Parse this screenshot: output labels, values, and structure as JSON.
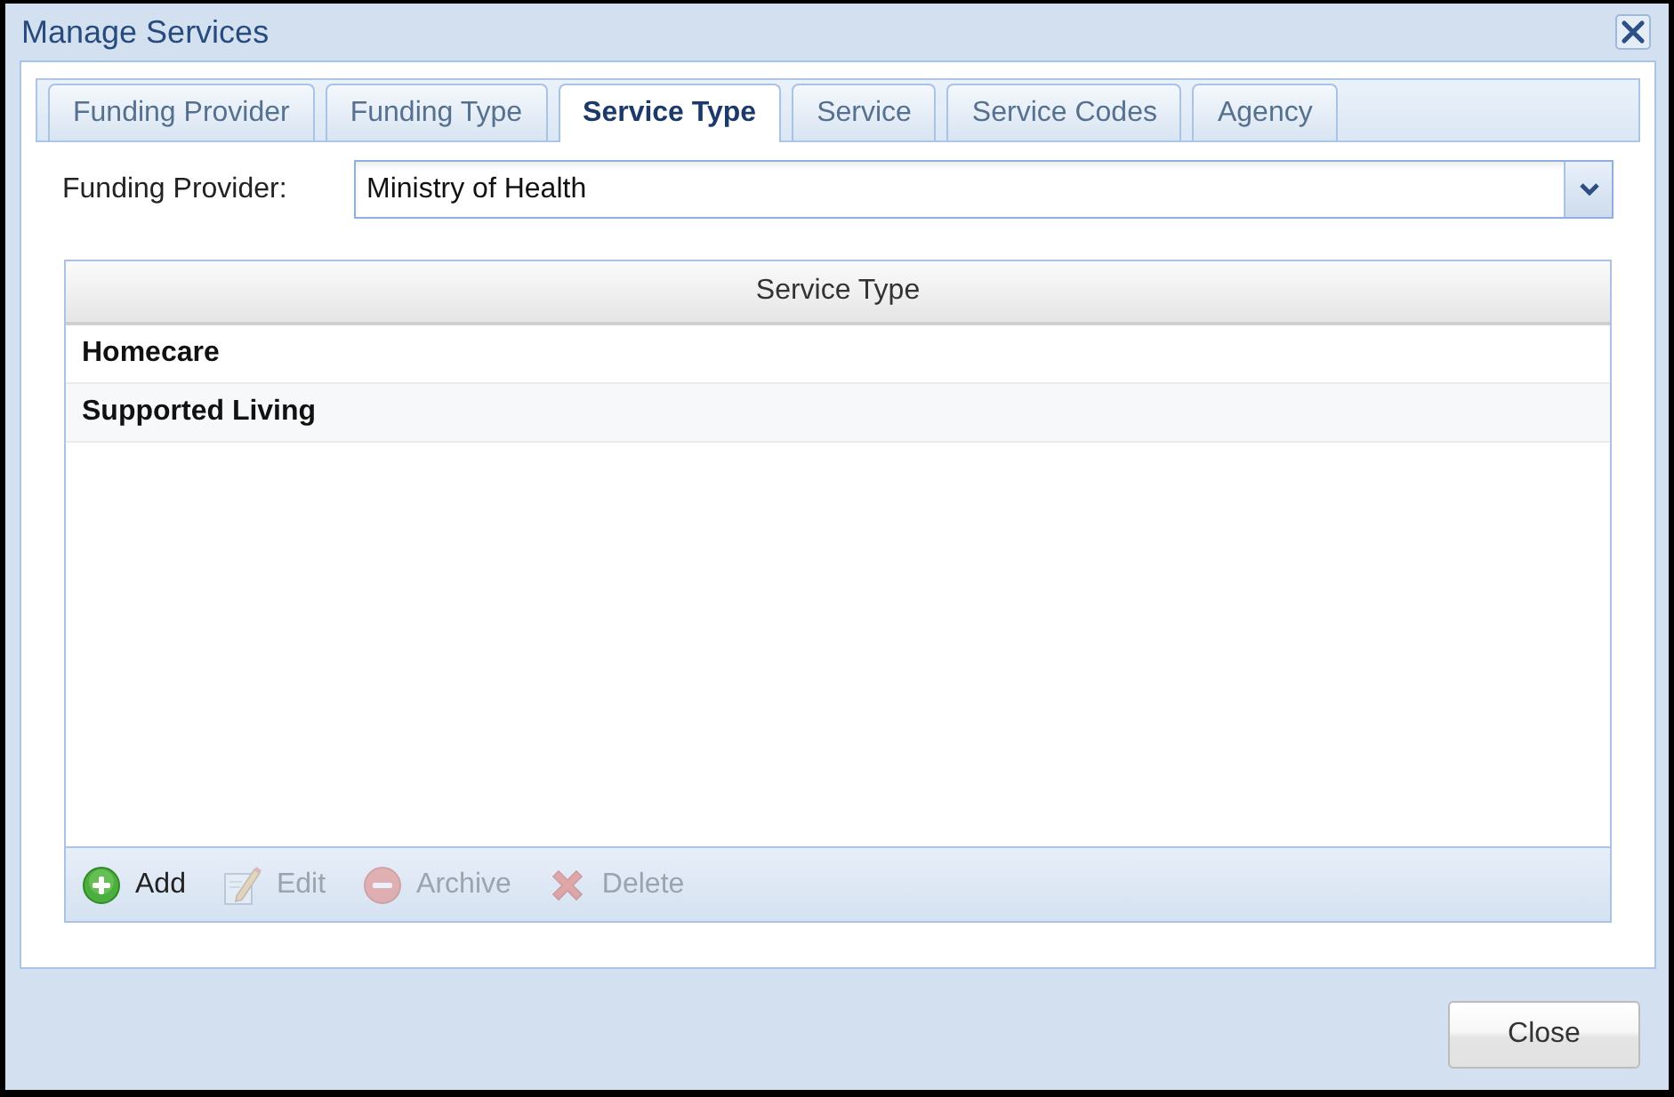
{
  "window": {
    "title": "Manage Services"
  },
  "tabs": [
    {
      "label": "Funding Provider",
      "selected": false
    },
    {
      "label": "Funding Type",
      "selected": false
    },
    {
      "label": "Service Type",
      "selected": true
    },
    {
      "label": "Service",
      "selected": false
    },
    {
      "label": "Service Codes",
      "selected": false
    },
    {
      "label": "Agency",
      "selected": false
    }
  ],
  "filter": {
    "label": "Funding Provider:",
    "value": "Ministry of Health"
  },
  "table": {
    "columns": [
      "Service Type"
    ],
    "rows": [
      [
        "Homecare"
      ],
      [
        "Supported Living"
      ]
    ]
  },
  "toolbar": [
    {
      "kind": "add",
      "label": "Add",
      "disabled": false
    },
    {
      "kind": "edit",
      "label": "Edit",
      "disabled": true
    },
    {
      "kind": "archive",
      "label": "Archive",
      "disabled": true
    },
    {
      "kind": "delete",
      "label": "Delete",
      "disabled": true
    }
  ],
  "buttons": [
    "Close"
  ]
}
